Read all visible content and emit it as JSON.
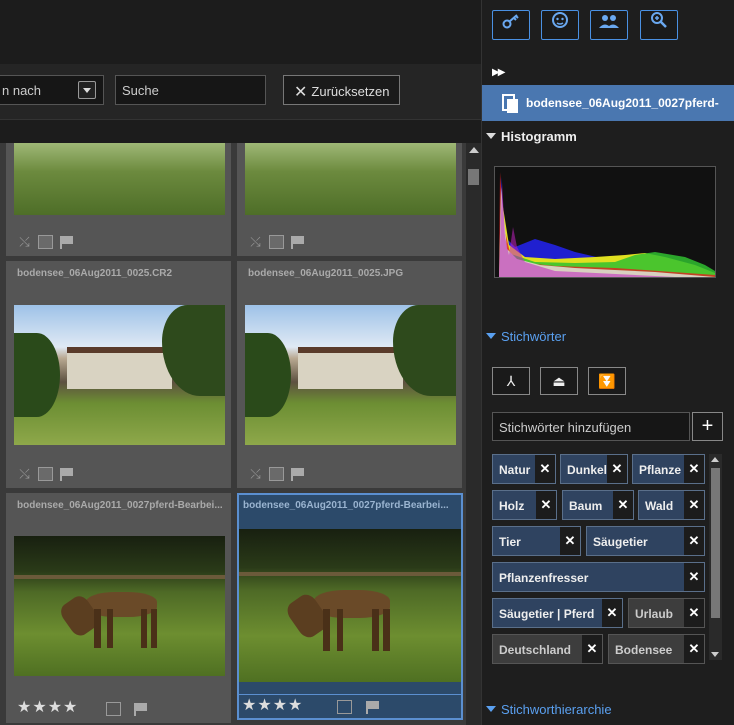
{
  "filter": {
    "sort_label": "n nach",
    "search_placeholder": "Suche",
    "reset_label": "Zurücksetzen"
  },
  "grid": {
    "cells": [
      {
        "title": "",
        "photo": "garden-icon"
      },
      {
        "title": "",
        "photo": "garden-icon"
      },
      {
        "title": "bodensee_06Aug2011_0025.CR2",
        "photo": "house-photo"
      },
      {
        "title": "bodensee_06Aug2011_0025.JPG",
        "photo": "house-photo"
      },
      {
        "title": "bodensee_06Aug2011_0027pferd-Bearbei...",
        "photo": "horse-photo",
        "stars": "★★★★"
      },
      {
        "title": "bodensee_06Aug2011_0027pferd-Bearbei...",
        "photo": "horse-photo",
        "stars": "★★★★",
        "selected": true
      }
    ]
  },
  "panel": {
    "toolbar_icons": [
      "key-icon",
      "face-icon",
      "people-icon",
      "zoom-icon"
    ],
    "filename": "bodensee_06Aug2011_0027pferd-",
    "histogram_label": "Histogramm",
    "keywords_label": "Stichwörter",
    "keywords_input_placeholder": "Stichwörter hinzufügen",
    "add_label": "+",
    "hierarchy_label": "Stichworthierarchie",
    "tags": [
      {
        "label": "Natur",
        "state": "active"
      },
      {
        "label": "Dunkel",
        "state": "active"
      },
      {
        "label": "Pflanze",
        "state": "active"
      },
      {
        "label": "Holz",
        "state": "active"
      },
      {
        "label": "Baum",
        "state": "active"
      },
      {
        "label": "Wald",
        "state": "active"
      },
      {
        "label": "Tier",
        "state": "active"
      },
      {
        "label": "Säugetier",
        "state": "active"
      },
      {
        "label": "Pflanzenfresser",
        "state": "active"
      },
      {
        "label": "Säugetier | Pferd",
        "state": "active"
      },
      {
        "label": "Urlaub",
        "state": "inactive"
      },
      {
        "label": "Deutschland",
        "state": "inactive"
      },
      {
        "label": "Bodensee",
        "state": "inactive"
      }
    ]
  },
  "colors": {
    "accent": "#4a90e2",
    "selection": "#4a77b0",
    "tag_bg": "#2f4360"
  }
}
